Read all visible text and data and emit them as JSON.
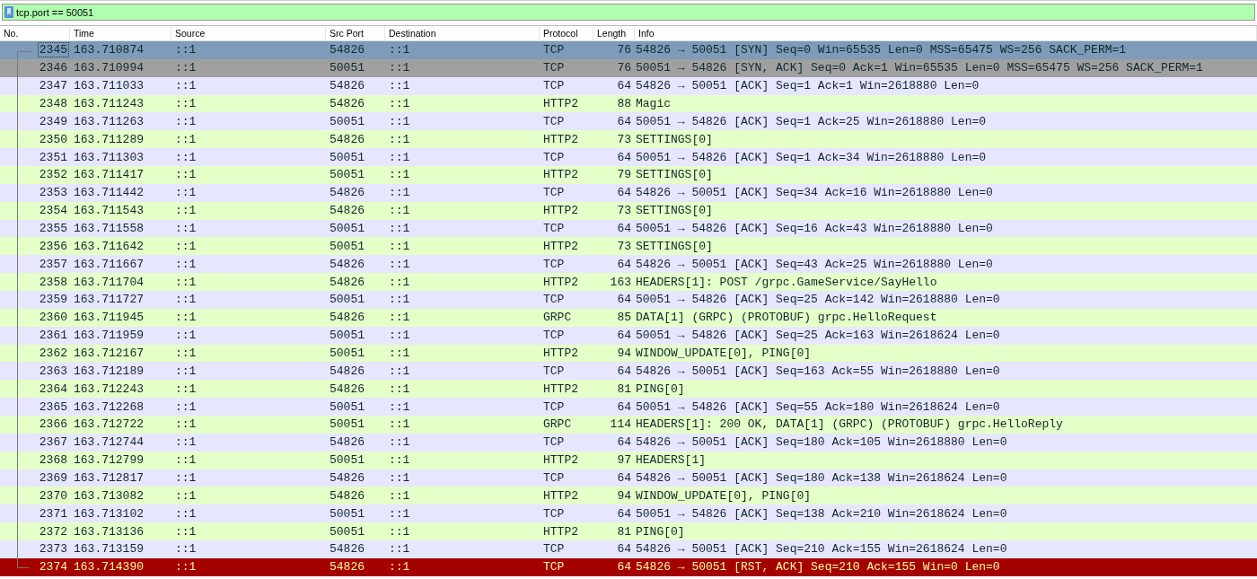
{
  "filter": {
    "value": "tcp.port == 50051"
  },
  "table": {
    "columns": [
      "No.",
      "Time",
      "Source",
      "Src Port",
      "Destination",
      "Protocol",
      "Length",
      "Info"
    ],
    "rows": [
      {
        "no": "2345",
        "time": "163.710874",
        "source": "::1",
        "src_port": "54826",
        "destination": "::1",
        "protocol": "TCP",
        "length": "76",
        "info": "54826 → 50051 [SYN] Seq=0 Win=65535 Len=0 MSS=65475 WS=256 SACK_PERM=1",
        "kind": "syn",
        "selected": true
      },
      {
        "no": "2346",
        "time": "163.710994",
        "source": "::1",
        "src_port": "50051",
        "destination": "::1",
        "protocol": "TCP",
        "length": "76",
        "info": "50051 → 54826 [SYN, ACK] Seq=0 Ack=1 Win=65535 Len=0 MSS=65475 WS=256 SACK_PERM=1",
        "kind": "syn",
        "selected": false
      },
      {
        "no": "2347",
        "time": "163.711033",
        "source": "::1",
        "src_port": "54826",
        "destination": "::1",
        "protocol": "TCP",
        "length": "64",
        "info": "54826 → 50051 [ACK] Seq=1 Ack=1 Win=2618880 Len=0",
        "kind": "tcp",
        "selected": false
      },
      {
        "no": "2348",
        "time": "163.711243",
        "source": "::1",
        "src_port": "54826",
        "destination": "::1",
        "protocol": "HTTP2",
        "length": "88",
        "info": "Magic",
        "kind": "http",
        "selected": false
      },
      {
        "no": "2349",
        "time": "163.711263",
        "source": "::1",
        "src_port": "50051",
        "destination": "::1",
        "protocol": "TCP",
        "length": "64",
        "info": "50051 → 54826 [ACK] Seq=1 Ack=25 Win=2618880 Len=0",
        "kind": "tcp",
        "selected": false
      },
      {
        "no": "2350",
        "time": "163.711289",
        "source": "::1",
        "src_port": "54826",
        "destination": "::1",
        "protocol": "HTTP2",
        "length": "73",
        "info": "SETTINGS[0]",
        "kind": "http",
        "selected": false
      },
      {
        "no": "2351",
        "time": "163.711303",
        "source": "::1",
        "src_port": "50051",
        "destination": "::1",
        "protocol": "TCP",
        "length": "64",
        "info": "50051 → 54826 [ACK] Seq=1 Ack=34 Win=2618880 Len=0",
        "kind": "tcp",
        "selected": false
      },
      {
        "no": "2352",
        "time": "163.711417",
        "source": "::1",
        "src_port": "50051",
        "destination": "::1",
        "protocol": "HTTP2",
        "length": "79",
        "info": "SETTINGS[0]",
        "kind": "http",
        "selected": false
      },
      {
        "no": "2353",
        "time": "163.711442",
        "source": "::1",
        "src_port": "54826",
        "destination": "::1",
        "protocol": "TCP",
        "length": "64",
        "info": "54826 → 50051 [ACK] Seq=34 Ack=16 Win=2618880 Len=0",
        "kind": "tcp",
        "selected": false
      },
      {
        "no": "2354",
        "time": "163.711543",
        "source": "::1",
        "src_port": "54826",
        "destination": "::1",
        "protocol": "HTTP2",
        "length": "73",
        "info": "SETTINGS[0]",
        "kind": "http",
        "selected": false
      },
      {
        "no": "2355",
        "time": "163.711558",
        "source": "::1",
        "src_port": "50051",
        "destination": "::1",
        "protocol": "TCP",
        "length": "64",
        "info": "50051 → 54826 [ACK] Seq=16 Ack=43 Win=2618880 Len=0",
        "kind": "tcp",
        "selected": false
      },
      {
        "no": "2356",
        "time": "163.711642",
        "source": "::1",
        "src_port": "50051",
        "destination": "::1",
        "protocol": "HTTP2",
        "length": "73",
        "info": "SETTINGS[0]",
        "kind": "http",
        "selected": false
      },
      {
        "no": "2357",
        "time": "163.711667",
        "source": "::1",
        "src_port": "54826",
        "destination": "::1",
        "protocol": "TCP",
        "length": "64",
        "info": "54826 → 50051 [ACK] Seq=43 Ack=25 Win=2618880 Len=0",
        "kind": "tcp",
        "selected": false
      },
      {
        "no": "2358",
        "time": "163.711704",
        "source": "::1",
        "src_port": "54826",
        "destination": "::1",
        "protocol": "HTTP2",
        "length": "163",
        "info": "HEADERS[1]: POST /grpc.GameService/SayHello",
        "kind": "http",
        "selected": false
      },
      {
        "no": "2359",
        "time": "163.711727",
        "source": "::1",
        "src_port": "50051",
        "destination": "::1",
        "protocol": "TCP",
        "length": "64",
        "info": "50051 → 54826 [ACK] Seq=25 Ack=142 Win=2618880 Len=0",
        "kind": "tcp",
        "selected": false
      },
      {
        "no": "2360",
        "time": "163.711945",
        "source": "::1",
        "src_port": "54826",
        "destination": "::1",
        "protocol": "GRPC",
        "length": "85",
        "info": "DATA[1] (GRPC) (PROTOBUF) grpc.HelloRequest",
        "kind": "http",
        "selected": false
      },
      {
        "no": "2361",
        "time": "163.711959",
        "source": "::1",
        "src_port": "50051",
        "destination": "::1",
        "protocol": "TCP",
        "length": "64",
        "info": "50051 → 54826 [ACK] Seq=25 Ack=163 Win=2618624 Len=0",
        "kind": "tcp",
        "selected": false
      },
      {
        "no": "2362",
        "time": "163.712167",
        "source": "::1",
        "src_port": "50051",
        "destination": "::1",
        "protocol": "HTTP2",
        "length": "94",
        "info": "WINDOW_UPDATE[0], PING[0]",
        "kind": "http",
        "selected": false
      },
      {
        "no": "2363",
        "time": "163.712189",
        "source": "::1",
        "src_port": "54826",
        "destination": "::1",
        "protocol": "TCP",
        "length": "64",
        "info": "54826 → 50051 [ACK] Seq=163 Ack=55 Win=2618880 Len=0",
        "kind": "tcp",
        "selected": false
      },
      {
        "no": "2364",
        "time": "163.712243",
        "source": "::1",
        "src_port": "54826",
        "destination": "::1",
        "protocol": "HTTP2",
        "length": "81",
        "info": "PING[0]",
        "kind": "http",
        "selected": false
      },
      {
        "no": "2365",
        "time": "163.712268",
        "source": "::1",
        "src_port": "50051",
        "destination": "::1",
        "protocol": "TCP",
        "length": "64",
        "info": "50051 → 54826 [ACK] Seq=55 Ack=180 Win=2618624 Len=0",
        "kind": "tcp",
        "selected": false
      },
      {
        "no": "2366",
        "time": "163.712722",
        "source": "::1",
        "src_port": "50051",
        "destination": "::1",
        "protocol": "GRPC",
        "length": "114",
        "info": "HEADERS[1]: 200 OK, DATA[1] (GRPC) (PROTOBUF) grpc.HelloReply",
        "kind": "http",
        "selected": false
      },
      {
        "no": "2367",
        "time": "163.712744",
        "source": "::1",
        "src_port": "54826",
        "destination": "::1",
        "protocol": "TCP",
        "length": "64",
        "info": "54826 → 50051 [ACK] Seq=180 Ack=105 Win=2618880 Len=0",
        "kind": "tcp",
        "selected": false
      },
      {
        "no": "2368",
        "time": "163.712799",
        "source": "::1",
        "src_port": "50051",
        "destination": "::1",
        "protocol": "HTTP2",
        "length": "97",
        "info": "HEADERS[1]",
        "kind": "http",
        "selected": false
      },
      {
        "no": "2369",
        "time": "163.712817",
        "source": "::1",
        "src_port": "54826",
        "destination": "::1",
        "protocol": "TCP",
        "length": "64",
        "info": "54826 → 50051 [ACK] Seq=180 Ack=138 Win=2618624 Len=0",
        "kind": "tcp",
        "selected": false
      },
      {
        "no": "2370",
        "time": "163.713082",
        "source": "::1",
        "src_port": "54826",
        "destination": "::1",
        "protocol": "HTTP2",
        "length": "94",
        "info": "WINDOW_UPDATE[0], PING[0]",
        "kind": "http",
        "selected": false
      },
      {
        "no": "2371",
        "time": "163.713102",
        "source": "::1",
        "src_port": "50051",
        "destination": "::1",
        "protocol": "TCP",
        "length": "64",
        "info": "50051 → 54826 [ACK] Seq=138 Ack=210 Win=2618624 Len=0",
        "kind": "tcp",
        "selected": false
      },
      {
        "no": "2372",
        "time": "163.713136",
        "source": "::1",
        "src_port": "50051",
        "destination": "::1",
        "protocol": "HTTP2",
        "length": "81",
        "info": "PING[0]",
        "kind": "http",
        "selected": false
      },
      {
        "no": "2373",
        "time": "163.713159",
        "source": "::1",
        "src_port": "54826",
        "destination": "::1",
        "protocol": "TCP",
        "length": "64",
        "info": "54826 → 50051 [ACK] Seq=210 Ack=155 Win=2618624 Len=0",
        "kind": "tcp",
        "selected": false
      },
      {
        "no": "2374",
        "time": "163.714390",
        "source": "::1",
        "src_port": "54826",
        "destination": "::1",
        "protocol": "TCP",
        "length": "64",
        "info": "54826 → 50051 [RST, ACK] Seq=210 Ack=155 Win=0 Len=0",
        "kind": "rst",
        "selected": false
      }
    ]
  }
}
